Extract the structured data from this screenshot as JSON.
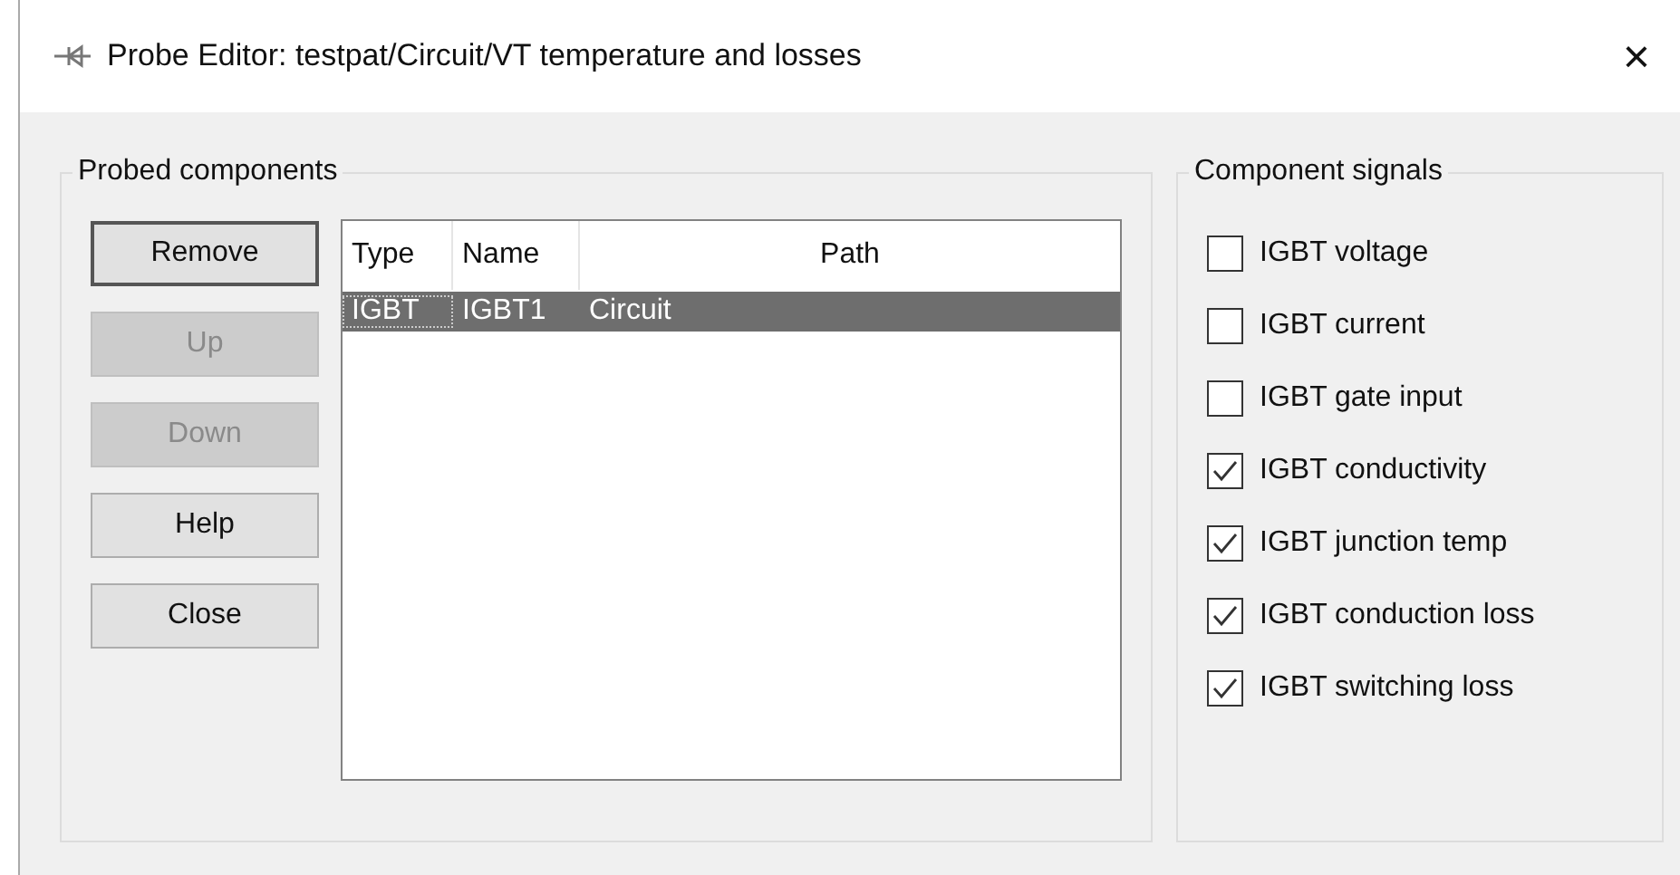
{
  "window": {
    "title": "Probe Editor: testpat/Circuit/VT temperature and losses",
    "close": "×"
  },
  "probed_components": {
    "title": "Probed components",
    "buttons": [
      {
        "label": "Remove",
        "disabled": false,
        "default": true
      },
      {
        "label": "Up",
        "disabled": true,
        "default": false
      },
      {
        "label": "Down",
        "disabled": true,
        "default": false
      },
      {
        "label": "Help",
        "disabled": false,
        "default": false
      },
      {
        "label": "Close",
        "disabled": false,
        "default": false
      }
    ],
    "table": {
      "columns": [
        "Type",
        "Name",
        "Path"
      ],
      "rows": [
        {
          "cells": [
            "IGBT",
            "IGBT1",
            "Circuit"
          ],
          "selected": true
        }
      ]
    }
  },
  "component_signals": {
    "title": "Component signals",
    "items": [
      {
        "label": "IGBT voltage",
        "checked": false
      },
      {
        "label": "IGBT current",
        "checked": false
      },
      {
        "label": "IGBT gate input",
        "checked": false
      },
      {
        "label": "IGBT conductivity",
        "checked": true
      },
      {
        "label": "IGBT junction temp",
        "checked": true
      },
      {
        "label": "IGBT conduction loss",
        "checked": true
      },
      {
        "label": "IGBT switching loss",
        "checked": true
      }
    ]
  }
}
